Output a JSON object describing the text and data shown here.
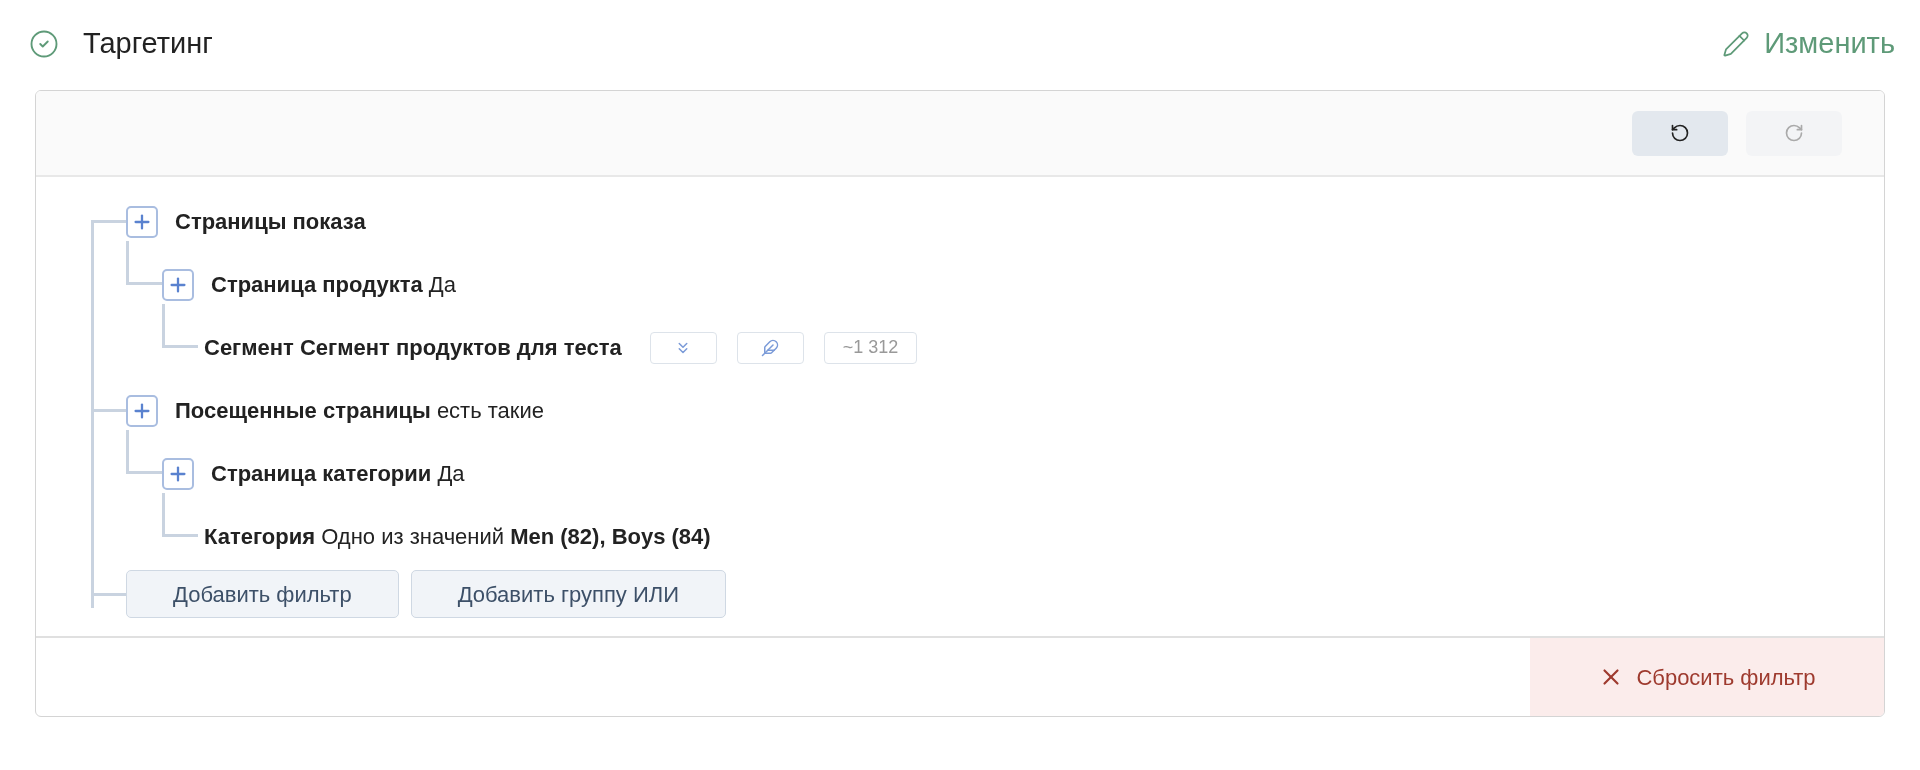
{
  "section": {
    "title": "Таргетинг",
    "done": true,
    "edit_link": "Изменить"
  },
  "toolbar": [
    {
      "kind": "undo",
      "disabled": false
    },
    {
      "kind": "redo",
      "disabled": true
    }
  ],
  "tree": [
    {
      "kind": "group",
      "label": "Страницы показа",
      "children": [
        {
          "kind": "group",
          "label": "Страница продукта",
          "value": "Да",
          "children": [
            {
              "kind": "segment",
              "label": "Сегмент Сегмент продуктов для теста",
              "count": "~1 312"
            }
          ]
        }
      ]
    },
    {
      "kind": "group",
      "label": "Посещенные страницы",
      "value": "есть такие",
      "children": [
        {
          "kind": "group",
          "label": "Страница категории",
          "value": "Да",
          "children": [
            {
              "kind": "filter",
              "label": "Категория",
              "value": "Одно из значений **Men (82), Boys (84)**"
            }
          ]
        }
      ]
    }
  ],
  "tree_buttons": [
    "Добавить фильтр",
    "Добавить группу ИЛИ"
  ],
  "reset_button": "Сбросить фильтр"
}
